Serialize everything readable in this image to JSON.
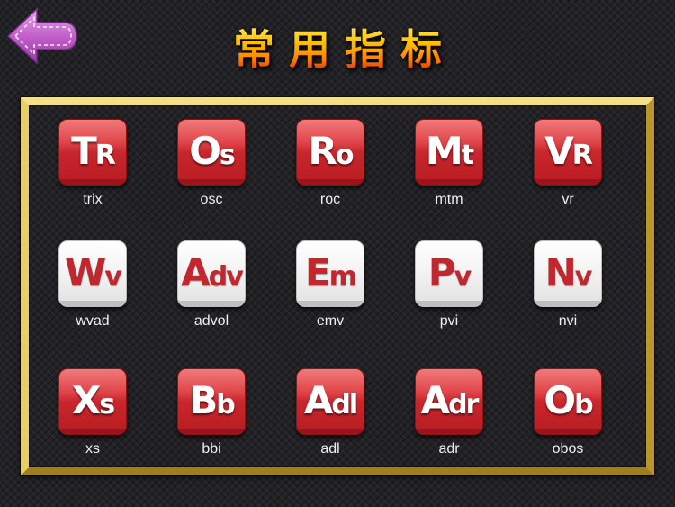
{
  "header": {
    "title": "常用指标",
    "back_icon": "back-arrow-icon",
    "back_color": "#c060c8"
  },
  "colors": {
    "tile_red": "#c8262c",
    "tile_white": "#f2f2f2",
    "frame_gold": "#d6b84c",
    "label_text": "#f0f0f0"
  },
  "indicators": [
    {
      "big": "T",
      "small": "R",
      "label": "trix",
      "style": "red"
    },
    {
      "big": "O",
      "small": "s",
      "label": "osc",
      "style": "red"
    },
    {
      "big": "R",
      "small": "o",
      "label": "roc",
      "style": "red"
    },
    {
      "big": "M",
      "small": "t",
      "label": "mtm",
      "style": "red"
    },
    {
      "big": "V",
      "small": "R",
      "label": "vr",
      "style": "red"
    },
    {
      "big": "W",
      "small": "v",
      "label": "wvad",
      "style": "white"
    },
    {
      "big": "A",
      "small": "dv",
      "label": "advol",
      "style": "white"
    },
    {
      "big": "E",
      "small": "m",
      "label": "emv",
      "style": "white"
    },
    {
      "big": "P",
      "small": "v",
      "label": "pvi",
      "style": "white"
    },
    {
      "big": "N",
      "small": "v",
      "label": "nvi",
      "style": "white"
    },
    {
      "big": "X",
      "small": "s",
      "label": "xs",
      "style": "red"
    },
    {
      "big": "B",
      "small": "b",
      "label": "bbi",
      "style": "red"
    },
    {
      "big": "A",
      "small": "dl",
      "label": "adl",
      "style": "red"
    },
    {
      "big": "A",
      "small": "dr",
      "label": "adr",
      "style": "red"
    },
    {
      "big": "O",
      "small": "b",
      "label": "obos",
      "style": "red"
    }
  ]
}
